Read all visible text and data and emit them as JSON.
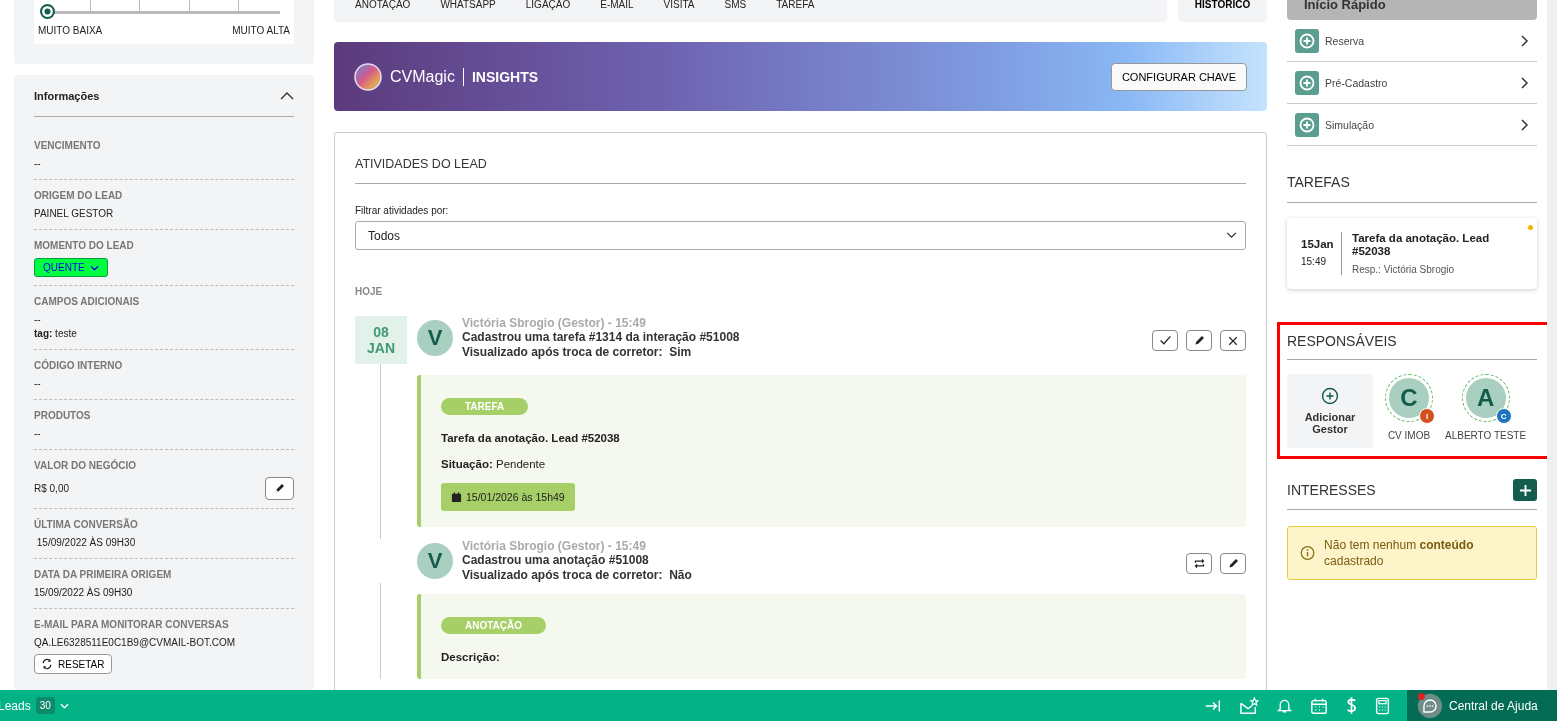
{
  "priority_slider": {
    "level": 0,
    "min_label": "MUITO BAIXA",
    "max_label": "MUITO ALTA"
  },
  "info_panel": {
    "title": "Informações",
    "expanded": true,
    "fields": [
      {
        "kind": "text",
        "label": "VENCIMENTO",
        "value": "--"
      },
      {
        "kind": "text",
        "label": "ORIGEM DO LEAD",
        "value": "PAINEL GESTOR"
      },
      {
        "kind": "dropdown",
        "label": "MOMENTO DO LEAD",
        "value": "QUENTE"
      },
      {
        "kind": "extra",
        "label": "CAMPOS ADICIONAIS",
        "value": "--",
        "extra": "**tag:** teste"
      },
      {
        "kind": "text",
        "label": "CÓDIGO INTERNO",
        "value": "--"
      },
      {
        "kind": "text",
        "label": "PRODUTOS",
        "value": "--"
      },
      {
        "kind": "editable",
        "label": "VALOR DO NEGÓCIO",
        "value": "R$ 0,00"
      },
      {
        "kind": "text",
        "label": "ÚLTIMA CONVERSÃO",
        "value": " 15/09/2022 ÀS 09H30"
      },
      {
        "kind": "text",
        "label": "DATA DA PRIMEIRA ORIGEM",
        "value": "15/09/2022 ÀS 09H30"
      },
      {
        "kind": "action",
        "label": "E-MAIL PARA MONITORAR CONVERSAS",
        "value": "QA.LE6328511E0C1B9@CVMAIL-BOT.COM",
        "button": "RESETAR"
      }
    ]
  },
  "tabs": [
    {
      "label": "ANOTAÇÃO",
      "selected": false
    },
    {
      "label": "WHATSAPP",
      "selected": false
    },
    {
      "label": "LIGAÇÃO",
      "selected": false
    },
    {
      "label": "E-MAIL",
      "selected": false
    },
    {
      "label": "VISITA",
      "selected": false
    },
    {
      "label": "SMS",
      "selected": false
    },
    {
      "label": "TAREFA",
      "selected": false
    }
  ],
  "history_button": "HISTÓRICO",
  "banner": {
    "brand": "CVMagic",
    "product": "INSIGHTS",
    "button": "CONFIGURAR CHAVE"
  },
  "activities": {
    "title": "ATIVIDADES DO LEAD",
    "filter_label": "Filtrar atividades por:",
    "filter_value": "Todos",
    "day": "HOJE",
    "entries": [
      {
        "kind": "tarefa",
        "day": "08",
        "month": "JAN",
        "avatar": "V",
        "author": "Victória Sbrogio (Gestor) - 15:49",
        "headline": "Cadastrou uma tarefa #1314 da interação #51008",
        "seen_label": "Visualizado após troca de corretor:",
        "seen_value": "Sim",
        "tag": "TAREFA",
        "detail_title": "Tarefa da anotação. Lead #52038",
        "status_label": "Situação:",
        "status_value": "Pendente",
        "due": "15/01/2026 às 15h49"
      },
      {
        "kind": "anotacao",
        "avatar": "V",
        "author": "Victória Sbrogio (Gestor) - 15:49",
        "headline": "Cadastrou uma anotação #51008",
        "seen_label": "Visualizado após troca de corretor:",
        "seen_value": "Não",
        "tag": "ANOTAÇÃO",
        "detail_title": "Descrição:"
      }
    ]
  },
  "quick_start": {
    "title": "Início Rápido",
    "items": [
      "Reserva",
      "Pré-Cadastro",
      "Simulação"
    ]
  },
  "tasks": {
    "title": "TAREFAS",
    "items": [
      {
        "date": "15Jan",
        "time": "15:49",
        "title": "Tarefa da anotação. Lead #52038",
        "owner": "Resp.: Victória Sbrogio"
      }
    ]
  },
  "responsibles": {
    "title": "RESPONSÁVEIS",
    "add_label": "Adicionar Gestor",
    "people": [
      {
        "letter": "C",
        "badge": "I",
        "color": "#d4501e",
        "name": "CV IMOB"
      },
      {
        "letter": "A",
        "badge": "C",
        "color": "#1f74c0",
        "name": "ALBERTO TESTE"
      }
    ]
  },
  "interests": {
    "title": "INTERESSES",
    "empty_note": "Não tem nenhum **conteúdo** cadastrado"
  },
  "bottom_bar": {
    "module": "Leads",
    "count": "30",
    "help": "Central de Ajuda"
  }
}
